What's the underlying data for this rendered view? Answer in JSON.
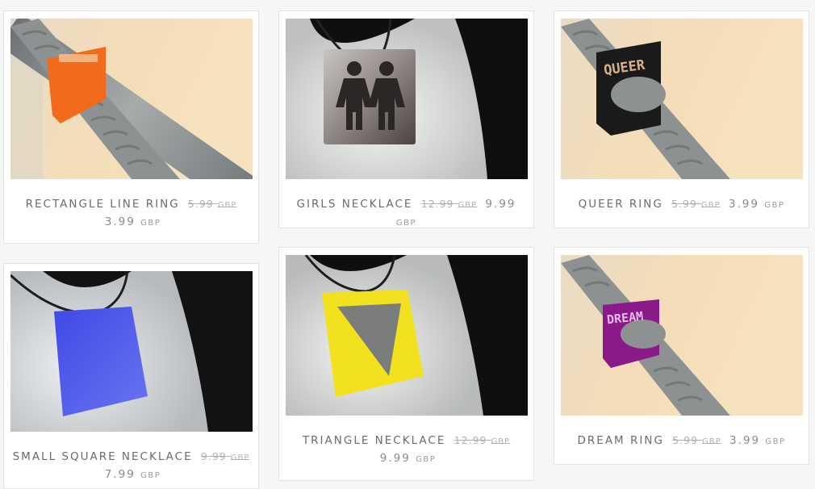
{
  "products": [
    {
      "name": "RECTANGLE LINE RING",
      "old_price": "5.99",
      "old_currency": "GBP",
      "price": "3.99",
      "currency": "GBP"
    },
    {
      "name": "GIRLS NECKLACE",
      "old_price": "12.99",
      "old_currency": "GBP",
      "price": "9.99",
      "currency": "GBP"
    },
    {
      "name": "QUEER RING",
      "old_price": "5.99",
      "old_currency": "GBP",
      "price": "3.99",
      "currency": "GBP",
      "engraving": "QUEER"
    },
    {
      "name": "SMALL SQUARE NECKLACE",
      "old_price": "9.99",
      "old_currency": "GBP",
      "price": "7.99",
      "currency": "GBP"
    },
    {
      "name": "TRIANGLE NECKLACE",
      "old_price": "12.99",
      "old_currency": "GBP",
      "price": "9.99",
      "currency": "GBP"
    },
    {
      "name": "DREAM RING",
      "old_price": "5.99",
      "old_currency": "GBP",
      "price": "3.99",
      "currency": "GBP",
      "engraving": "DREAM"
    }
  ],
  "colors": {
    "orange_ring": "#f26a1b",
    "black_ring": "#1a1a1a",
    "blue_necklace": "#4a52e8",
    "yellow_necklace": "#f2e11e",
    "purple_ring": "#8a1a8a"
  }
}
